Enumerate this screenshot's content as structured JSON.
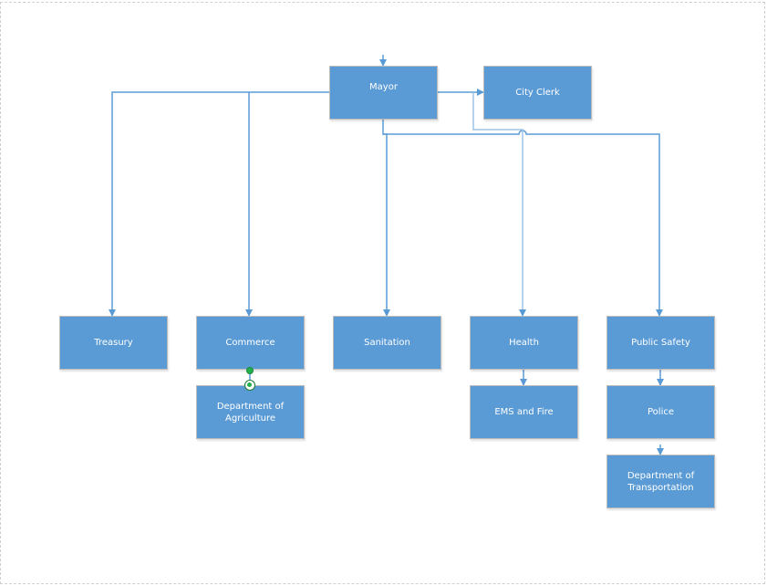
{
  "diagram": {
    "nodes": {
      "mayor": "Mayor",
      "city_clerk": "City Clerk",
      "treasury": "Treasury",
      "commerce": "Commerce",
      "sanitation": "Sanitation",
      "health": "Health",
      "public_safety": "Public Safety",
      "agriculture": "Department of Agriculture",
      "ems_fire": "EMS and Fire",
      "police": "Police",
      "transportation": "Department of Transportation"
    },
    "edges": [
      [
        "mayor",
        "city_clerk"
      ],
      [
        "mayor",
        "treasury"
      ],
      [
        "mayor",
        "commerce"
      ],
      [
        "mayor",
        "sanitation"
      ],
      [
        "mayor",
        "health"
      ],
      [
        "mayor",
        "public_safety"
      ],
      [
        "commerce",
        "agriculture"
      ],
      [
        "health",
        "ems_fire"
      ],
      [
        "public_safety",
        "police"
      ],
      [
        "police",
        "transportation"
      ]
    ],
    "colors": {
      "box_fill": "#5b9bd5",
      "connector": "#5b9bd5",
      "selection_handle": "#22b14c"
    }
  }
}
